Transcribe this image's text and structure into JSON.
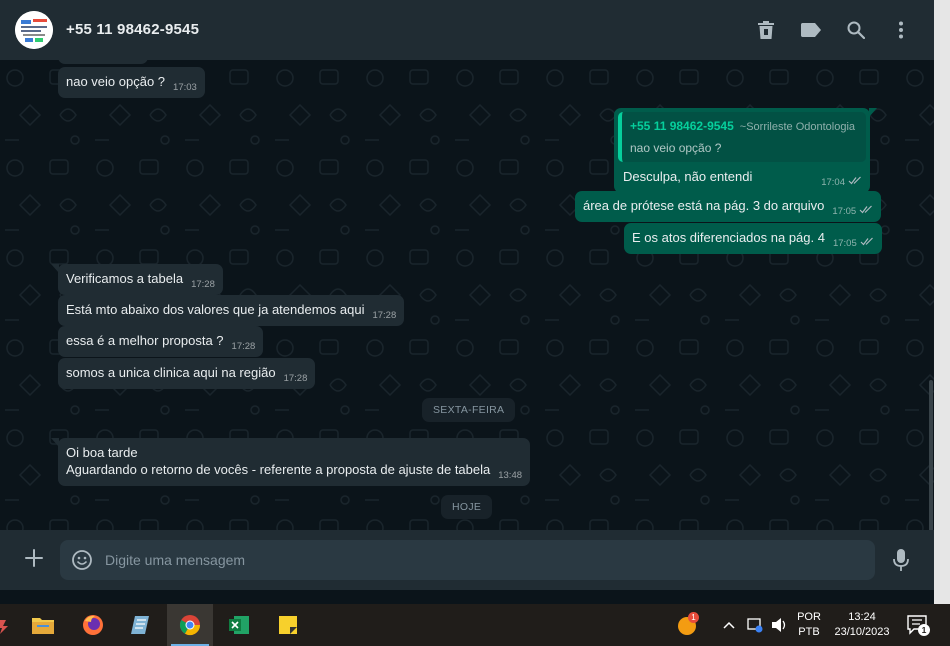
{
  "header": {
    "contact_name": "+55 11 98462-9545",
    "icons": [
      "delete-icon",
      "label-icon",
      "search-icon",
      "menu-icon"
    ]
  },
  "messages": {
    "m1": {
      "text": "nao veio opção ?",
      "time": "17:03"
    },
    "m2": {
      "quote_name": "+55 11 98462-9545",
      "quote_pushname": "~Sorrileste Odontologia",
      "quote_text": "nao veio opção ?",
      "text": "Desculpa, não entendi",
      "time": "17:04"
    },
    "m3": {
      "text": "área de prótese está na pág. 3 do arquivo",
      "time": "17:05"
    },
    "m4": {
      "text": "E os atos diferenciados na pág. 4",
      "time": "17:05"
    },
    "m5": {
      "text": "Verificamos a tabela",
      "time": "17:28"
    },
    "m6": {
      "text": "Está mto abaixo dos valores que ja atendemos aqui",
      "time": "17:28"
    },
    "m7": {
      "text": "essa é a melhor proposta ?",
      "time": "17:28"
    },
    "m8": {
      "text": "somos a unica clinica aqui na região",
      "time": "17:28"
    },
    "m9": {
      "line1": "Oi boa tarde",
      "line2": "Aguardando o retorno de vocês -  referente a proposta de ajuste de tabela",
      "time": "13:48"
    }
  },
  "dates": {
    "friday": "SEXTA-FEIRA",
    "today": "HOJE"
  },
  "composer": {
    "placeholder": "Digite uma mensagem"
  },
  "taskbar": {
    "apps": [
      "file-explorer",
      "firefox",
      "notepad",
      "chrome",
      "excel",
      "sticky-notes"
    ],
    "language_line1": "POR",
    "language_line2": "PTB",
    "time": "13:24",
    "date": "23/10/2023",
    "notification_count": "1",
    "badge_count": "1"
  },
  "colors": {
    "outgoing_bubble": "#005c4b",
    "incoming_bubble": "#202c33",
    "accent": "#06cf9c",
    "background": "#0b141a",
    "header": "#202c33"
  }
}
